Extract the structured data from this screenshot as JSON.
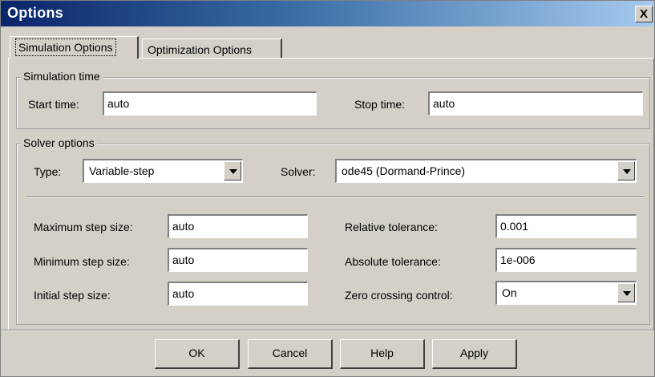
{
  "window": {
    "title": "Options",
    "close_glyph": "X"
  },
  "tabs": [
    {
      "label": "Simulation Options",
      "active": true
    },
    {
      "label": "Optimization Options",
      "active": false
    }
  ],
  "simulation_time": {
    "legend": "Simulation time",
    "start_label": "Start time:",
    "start_value": "auto",
    "stop_label": "Stop time:",
    "stop_value": "auto"
  },
  "solver_options": {
    "legend": "Solver options",
    "type_label": "Type:",
    "type_value": "Variable-step",
    "solver_label": "Solver:",
    "solver_value": "ode45 (Dormand-Prince)",
    "max_step_label": "Maximum step size:",
    "max_step_value": "auto",
    "min_step_label": "Minimum step size:",
    "min_step_value": "auto",
    "init_step_label": "Initial step size:",
    "init_step_value": "auto",
    "rel_tol_label": "Relative tolerance:",
    "rel_tol_value": "0.001",
    "abs_tol_label": "Absolute tolerance:",
    "abs_tol_value": "1e-006",
    "zero_cross_label": "Zero crossing control:",
    "zero_cross_value": "On"
  },
  "buttons": {
    "ok": "OK",
    "cancel": "Cancel",
    "help": "Help",
    "apply": "Apply"
  },
  "colors": {
    "face": "#d4d0c8",
    "title_start": "#0a246a",
    "title_end": "#a6caf0"
  },
  "icons": {
    "close": "close-icon",
    "dropdown": "chevron-down-icon"
  }
}
